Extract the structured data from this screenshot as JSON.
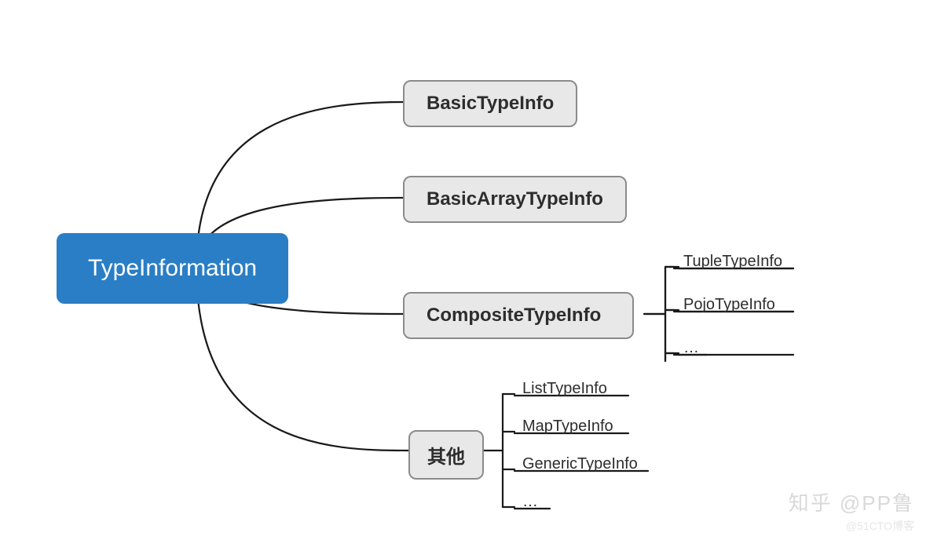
{
  "root": {
    "label": "TypeInformation"
  },
  "children": [
    {
      "id": "basic",
      "label": "BasicTypeInfo"
    },
    {
      "id": "basicArray",
      "label": "BasicArrayTypeInfo"
    },
    {
      "id": "composite",
      "label": "CompositeTypeInfo",
      "leaves": [
        {
          "label": "TupleTypeInfo"
        },
        {
          "label": "PojoTypeInfo"
        },
        {
          "label": "…"
        }
      ]
    },
    {
      "id": "other",
      "label": "其他",
      "leaves": [
        {
          "label": "ListTypeInfo"
        },
        {
          "label": "MapTypeInfo"
        },
        {
          "label": "GenericTypeInfo"
        },
        {
          "label": "…"
        }
      ]
    }
  ],
  "watermark": {
    "zhihu": "知乎 @PP鲁",
    "cto": "@51CTO博客"
  },
  "colors": {
    "root_bg": "#2a7ec5",
    "root_fg": "#ffffff",
    "child_bg": "#e8e8e8",
    "child_border": "#8b8b8b",
    "stroke": "#1a1a1a"
  }
}
